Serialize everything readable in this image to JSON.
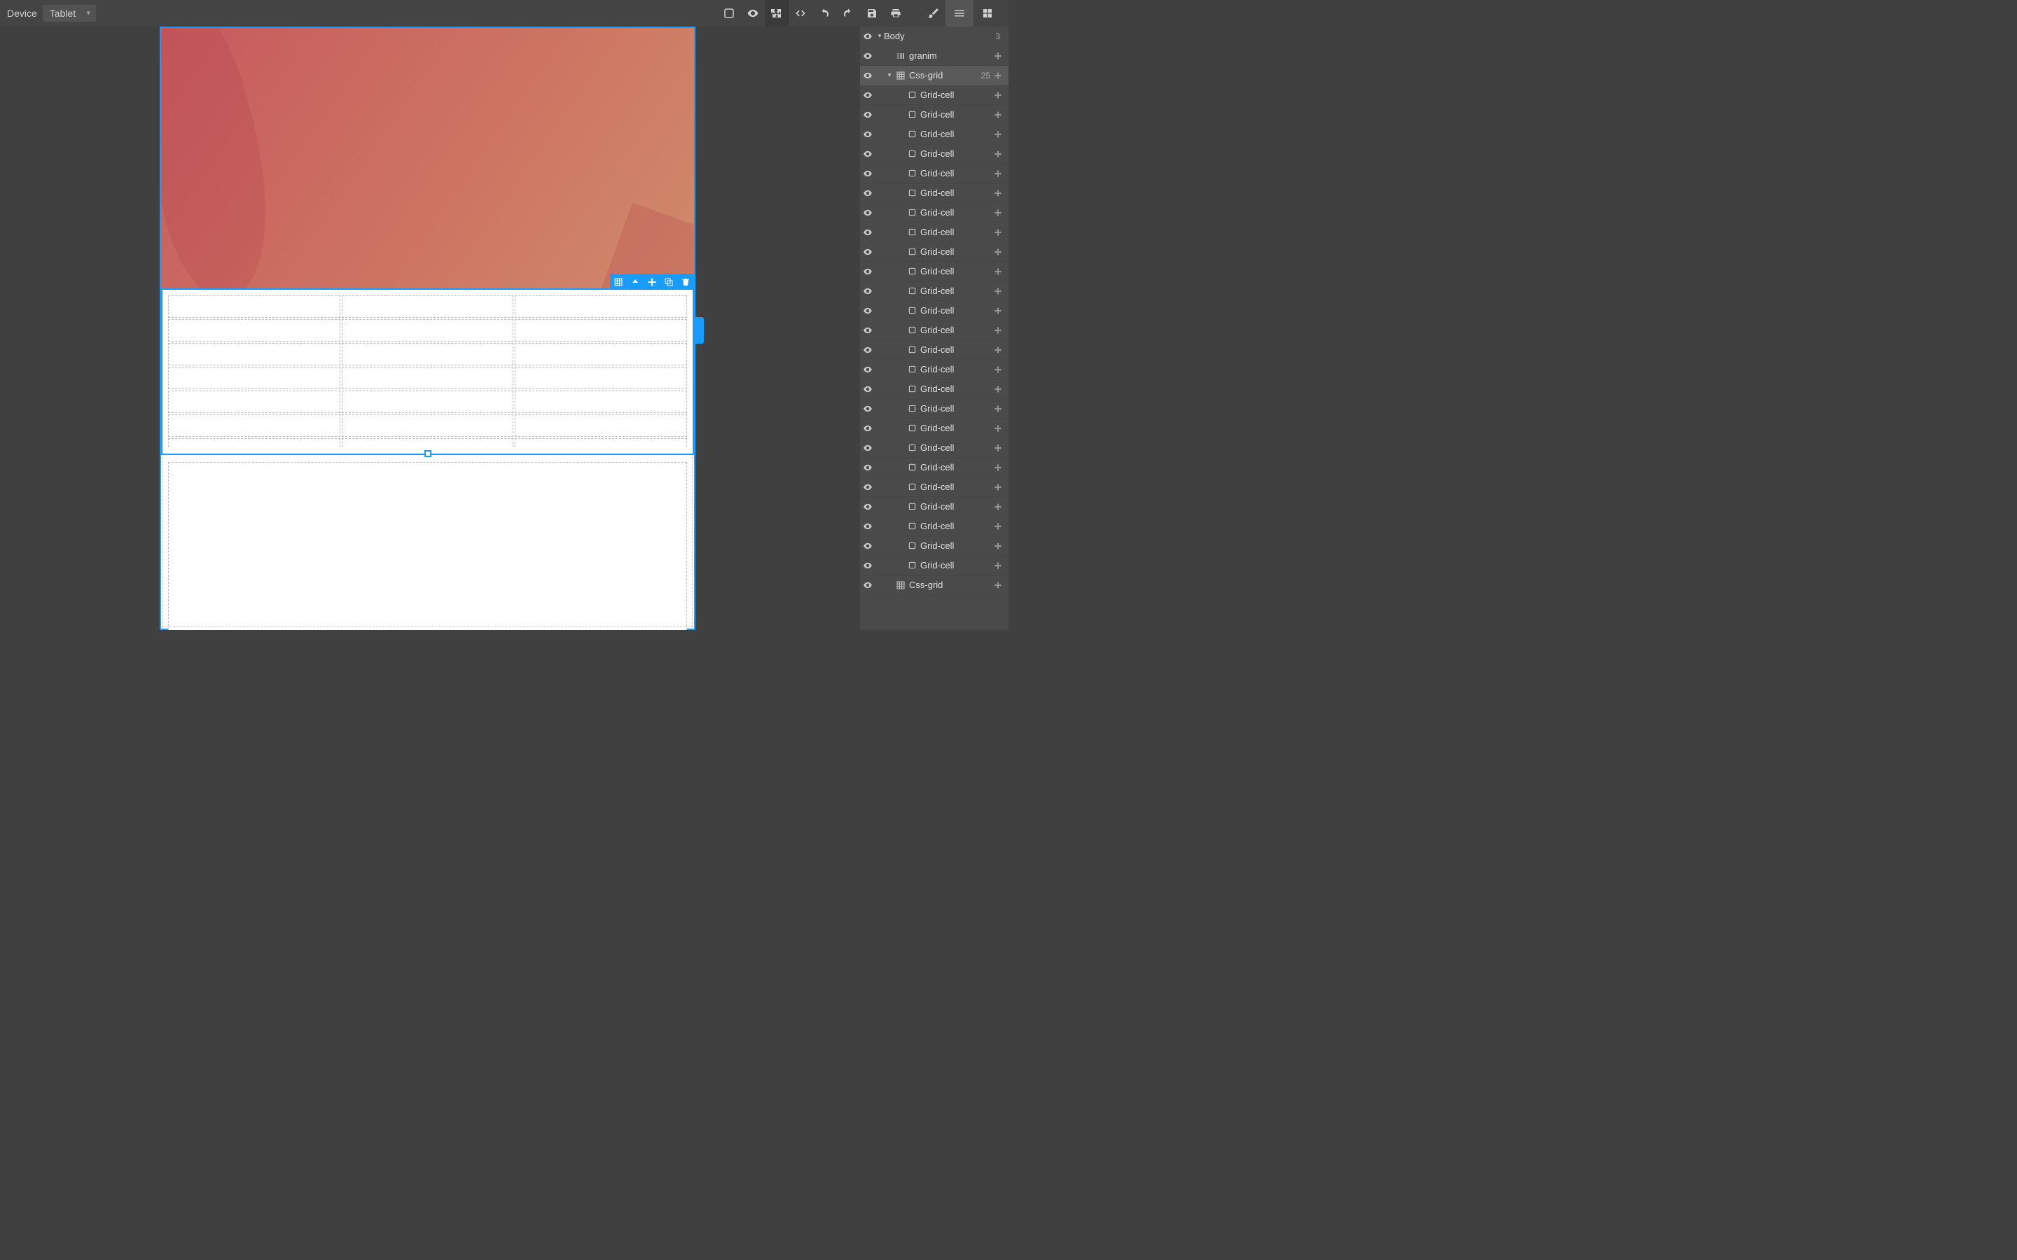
{
  "toolbar": {
    "device_label": "Device",
    "device_value": "Tablet"
  },
  "layers": {
    "root": {
      "label": "Body",
      "count": "3"
    },
    "items": [
      {
        "label": "granim",
        "type": "comp",
        "indent": 1,
        "count": ""
      },
      {
        "label": "Css-grid",
        "type": "grid",
        "indent": 1,
        "count": "25",
        "caret": true,
        "selected": true
      },
      {
        "label": "Grid-cell",
        "type": "cell",
        "indent": 2,
        "count": ""
      },
      {
        "label": "Grid-cell",
        "type": "cell",
        "indent": 2,
        "count": ""
      },
      {
        "label": "Grid-cell",
        "type": "cell",
        "indent": 2,
        "count": ""
      },
      {
        "label": "Grid-cell",
        "type": "cell",
        "indent": 2,
        "count": ""
      },
      {
        "label": "Grid-cell",
        "type": "cell",
        "indent": 2,
        "count": ""
      },
      {
        "label": "Grid-cell",
        "type": "cell",
        "indent": 2,
        "count": ""
      },
      {
        "label": "Grid-cell",
        "type": "cell",
        "indent": 2,
        "count": ""
      },
      {
        "label": "Grid-cell",
        "type": "cell",
        "indent": 2,
        "count": ""
      },
      {
        "label": "Grid-cell",
        "type": "cell",
        "indent": 2,
        "count": ""
      },
      {
        "label": "Grid-cell",
        "type": "cell",
        "indent": 2,
        "count": ""
      },
      {
        "label": "Grid-cell",
        "type": "cell",
        "indent": 2,
        "count": ""
      },
      {
        "label": "Grid-cell",
        "type": "cell",
        "indent": 2,
        "count": ""
      },
      {
        "label": "Grid-cell",
        "type": "cell",
        "indent": 2,
        "count": ""
      },
      {
        "label": "Grid-cell",
        "type": "cell",
        "indent": 2,
        "count": ""
      },
      {
        "label": "Grid-cell",
        "type": "cell",
        "indent": 2,
        "count": ""
      },
      {
        "label": "Grid-cell",
        "type": "cell",
        "indent": 2,
        "count": ""
      },
      {
        "label": "Grid-cell",
        "type": "cell",
        "indent": 2,
        "count": ""
      },
      {
        "label": "Grid-cell",
        "type": "cell",
        "indent": 2,
        "count": ""
      },
      {
        "label": "Grid-cell",
        "type": "cell",
        "indent": 2,
        "count": ""
      },
      {
        "label": "Grid-cell",
        "type": "cell",
        "indent": 2,
        "count": ""
      },
      {
        "label": "Grid-cell",
        "type": "cell",
        "indent": 2,
        "count": ""
      },
      {
        "label": "Grid-cell",
        "type": "cell",
        "indent": 2,
        "count": ""
      },
      {
        "label": "Grid-cell",
        "type": "cell",
        "indent": 2,
        "count": ""
      },
      {
        "label": "Grid-cell",
        "type": "cell",
        "indent": 2,
        "count": ""
      },
      {
        "label": "Grid-cell",
        "type": "cell",
        "indent": 2,
        "count": ""
      },
      {
        "label": "Css-grid",
        "type": "grid",
        "indent": 1,
        "count": ""
      }
    ]
  }
}
